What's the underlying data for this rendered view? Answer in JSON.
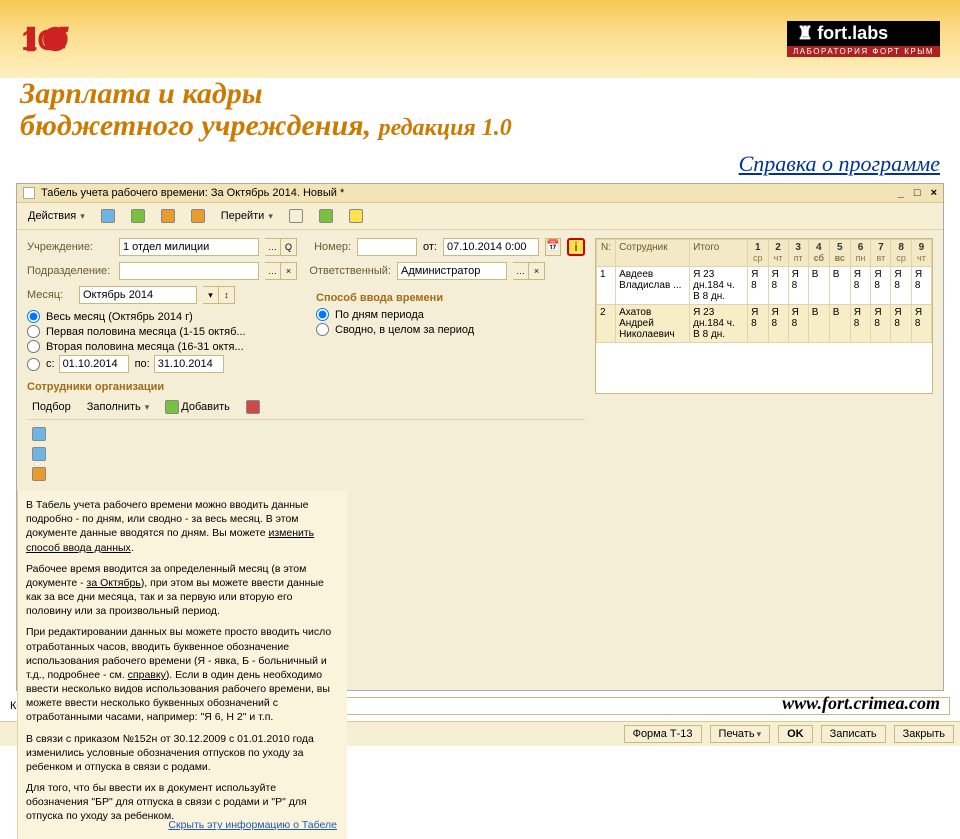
{
  "banner": {
    "title_line1": "Зарплата и кадры",
    "title_line2": "бюджетного учреждения,",
    "title_edition": "редакция 1.0",
    "fortlabs_top": "fort.labs",
    "fortlabs_bot": "ЛАБОРАТОРИЯ ФОРТ КРЫМ"
  },
  "sub_link": "Справка о программе",
  "site_url": "www.fort.crimea.com",
  "window": {
    "title": "Табель учета рабочего времени: За Октябрь 2014. Новый *",
    "toolbar": {
      "actions": "Действия",
      "goto": "Перейти"
    },
    "form": {
      "org_label": "Учреждение:",
      "org_value": "1 отдел милиции",
      "num_label": "Номер:",
      "num_value": "",
      "date_label": "от:",
      "date_value": "07.10.2014 0:00",
      "dept_label": "Подразделение:",
      "dept_value": "",
      "resp_label": "Ответственный:",
      "resp_value": "Администратор",
      "month_label": "Месяц:",
      "month_value": "Октябрь 2014",
      "method_label": "Способ ввода времени",
      "period_full": "Весь месяц (Октябрь 2014 г)",
      "period_first": "Первая половина месяца (1-15 октяб...",
      "period_second": "Вторая половина месяца (16-31 октя...",
      "period_custom_lbl": "с:",
      "period_from": "01.10.2014",
      "period_to_lbl": "по:",
      "period_to": "31.10.2014",
      "method_daily": "По дням периода",
      "method_summary": "Сводно, в целом за период"
    },
    "employees": {
      "section": "Сотрудники организации",
      "toolbar": {
        "select": "Подбор",
        "fill": "Заполнить",
        "add": "Добавить"
      },
      "cols": {
        "num": "N:",
        "emp": "Сотрудник",
        "total": "Итого"
      },
      "days": [
        {
          "n": "1",
          "wd": "ср"
        },
        {
          "n": "2",
          "wd": "чт"
        },
        {
          "n": "3",
          "wd": "пт"
        },
        {
          "n": "4",
          "wd": "сб",
          "red": true
        },
        {
          "n": "5",
          "wd": "вс",
          "red": true
        },
        {
          "n": "6",
          "wd": "пн"
        },
        {
          "n": "7",
          "wd": "вт"
        },
        {
          "n": "8",
          "wd": "ср"
        },
        {
          "n": "9",
          "wd": "чт"
        }
      ],
      "rows": [
        {
          "n": "1",
          "name": "Авдеев Владислав ...",
          "total": "Я 23 дн.184 ч. В 8 дн.",
          "cells": [
            "Я 8",
            "Я 8",
            "Я 8",
            "В",
            "В",
            "Я 8",
            "Я 8",
            "Я 8",
            "Я 8"
          ]
        },
        {
          "n": "2",
          "name": "Ахатов Андрей Николаевич",
          "total": "Я 23 дн.184 ч. В 8 дн.",
          "cells": [
            "Я 8",
            "Я 8",
            "Я 8",
            "В",
            "В",
            "Я 8",
            "Я 8",
            "Я 8",
            "Я 8"
          ],
          "selected": true
        }
      ]
    },
    "comment_label": "Комментарий:",
    "comment_value": "",
    "help": {
      "p1a": "В Табель учета рабочего времени можно вводить данные подробно - по дням, или сводно - за весь месяц. В этом документе данные вводятся по дням. Вы можете ",
      "p1u": "изменить способ ввода данных",
      "p1b": ".",
      "p2a": "Рабочее время вводится за определенный месяц (в этом документе - ",
      "p2u": "за Октябрь",
      "p2b": "), при этом вы можете ввести данные как за все дни месяца, так и за первую или вторую его половину или за произвольный период.",
      "p3a": "При редактировании данных вы можете просто вводить число отработанных часов, вводить буквенное обозначение использования рабочего времени (Я - явка, Б - больничный и т.д., подробнее - см. ",
      "p3u": "справку",
      "p3b": "). Если в один день необходимо ввести несколько видов использования рабочего времени, вы можете ввести несколько буквенных обозначений с отработанными часами, например: \"Я 6, Н 2\" и т.п.",
      "p4": "В связи с приказом №152н от 30.12.2009 с 01.01.2010 года изменились условные обозначения отпусков по уходу за ребенком и отпуска в связи с родами.",
      "p5": "Для того, что бы ввести их в документ используйте обозначения \"БР\" для отпуска в связи с родами и \"Р\" для отпуска по уходу за ребенком.",
      "hide": "Скрыть эту информацию о Табеле"
    },
    "footer": {
      "form": "Форма Т-13",
      "print": "Печать",
      "ok": "OK",
      "save": "Записать",
      "close": "Закрыть"
    }
  }
}
